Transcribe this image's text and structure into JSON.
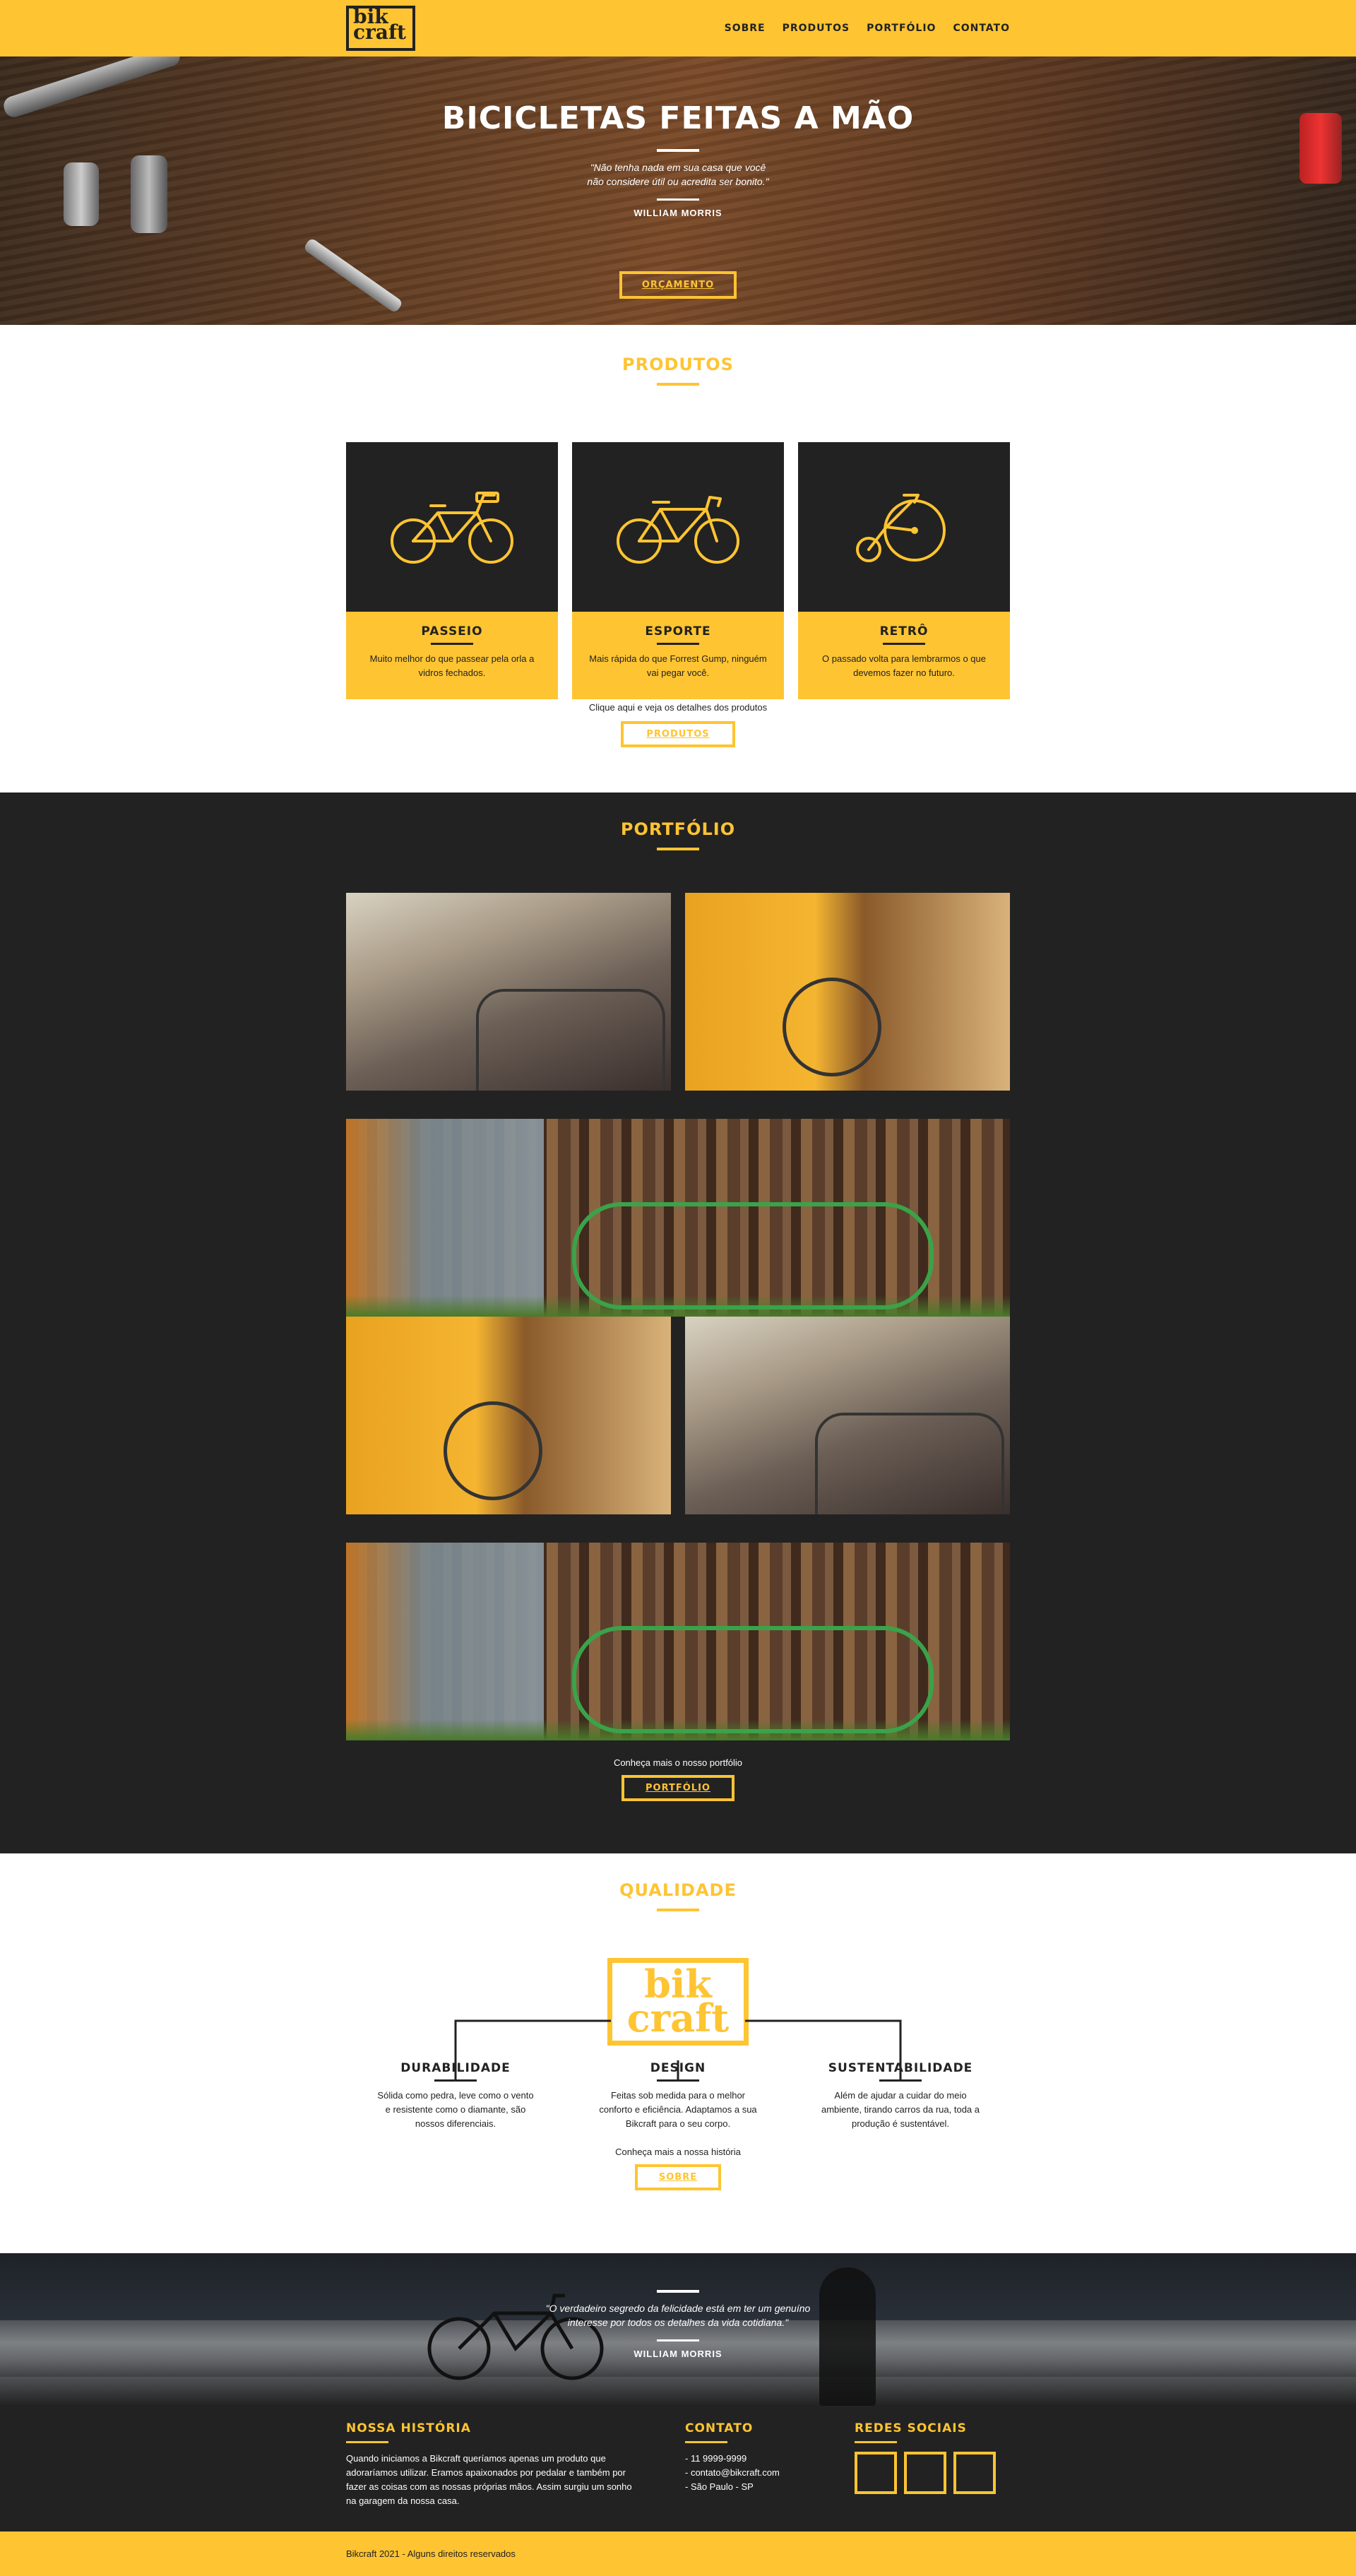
{
  "brand": {
    "logo_line1": "bik",
    "logo_line2": "craft"
  },
  "nav": {
    "items": [
      "SOBRE",
      "PRODUTOS",
      "PORTFÓLIO",
      "CONTATO"
    ]
  },
  "hero": {
    "title": "BICICLETAS FEITAS A MÃO",
    "quote": "\"Não tenha nada em sua casa que você não considere útil ou acredita ser bonito.\"",
    "author": "WILLIAM MORRIS",
    "button": "ORÇAMENTO"
  },
  "produtos": {
    "title": "PRODUTOS",
    "items": [
      {
        "name": "PASSEIO",
        "desc": "Muito melhor do que passear pela orla a vidros fechados.",
        "icon": "bike-icon"
      },
      {
        "name": "ESPORTE",
        "desc": "Mais rápida do que Forrest Gump, ninguém vai pegar você.",
        "icon": "sport-bike-icon"
      },
      {
        "name": "RETRÔ",
        "desc": "O passado volta para lembrarmos o que devemos fazer no futuro.",
        "icon": "retro-bike-icon"
      }
    ],
    "cta_text": "Clique aqui e veja os detalhes dos produtos",
    "button": "PRODUTOS"
  },
  "portfolio": {
    "title": "PORTFÓLIO",
    "cta_text": "Conheça mais o nosso portfólio",
    "button": "PORTFÓLIO"
  },
  "qualidade": {
    "title": "QUALIDADE",
    "logo_line1": "bik",
    "logo_line2": "craft",
    "items": [
      {
        "name": "DURABILIDADE",
        "desc": "Sólida como pedra, leve como o vento e resistente como o diamante, são nossos diferenciais."
      },
      {
        "name": "DESIGN",
        "desc": "Feitas sob medida para o melhor conforto e eficiência. Adaptamos a sua Bikcraft para o seu corpo."
      },
      {
        "name": "SUSTENTABILIDADE",
        "desc": "Além de ajudar a cuidar do meio ambiente, tirando carros da rua, toda a produção é sustentável."
      }
    ],
    "cta_text": "Conheça mais a nossa história",
    "button": "SOBRE"
  },
  "banner": {
    "quote": "\"O verdadeiro segredo da felicidade está em ter um genuíno interesse por todos os detalhes da vida cotidiana.\"",
    "author": "WILLIAM MORRIS"
  },
  "footer": {
    "historia_title": "NOSSA HISTÓRIA",
    "historia_text": "Quando iniciamos a Bikcraft queríamos apenas um produto que adoraríamos utilizar. Eramos apaixonados por pedalar e também por fazer as coisas com as nossas próprias mãos. Assim surgiu um sonho na garagem da nossa casa.",
    "contato_title": "CONTATO",
    "contato_items": [
      "- 11 9999-9999",
      "- contato@bikcraft.com",
      "- São Paulo - SP"
    ],
    "redes_title": "REDES SOCIAIS",
    "redes_icons": [
      "facebook-icon",
      "instagram-icon",
      "twitter-icon"
    ]
  },
  "copyright": "Bikcraft 2021 - Alguns direitos reservados",
  "colors": {
    "accent": "#FEC432",
    "dark": "#222222",
    "white": "#FFFFFF"
  }
}
